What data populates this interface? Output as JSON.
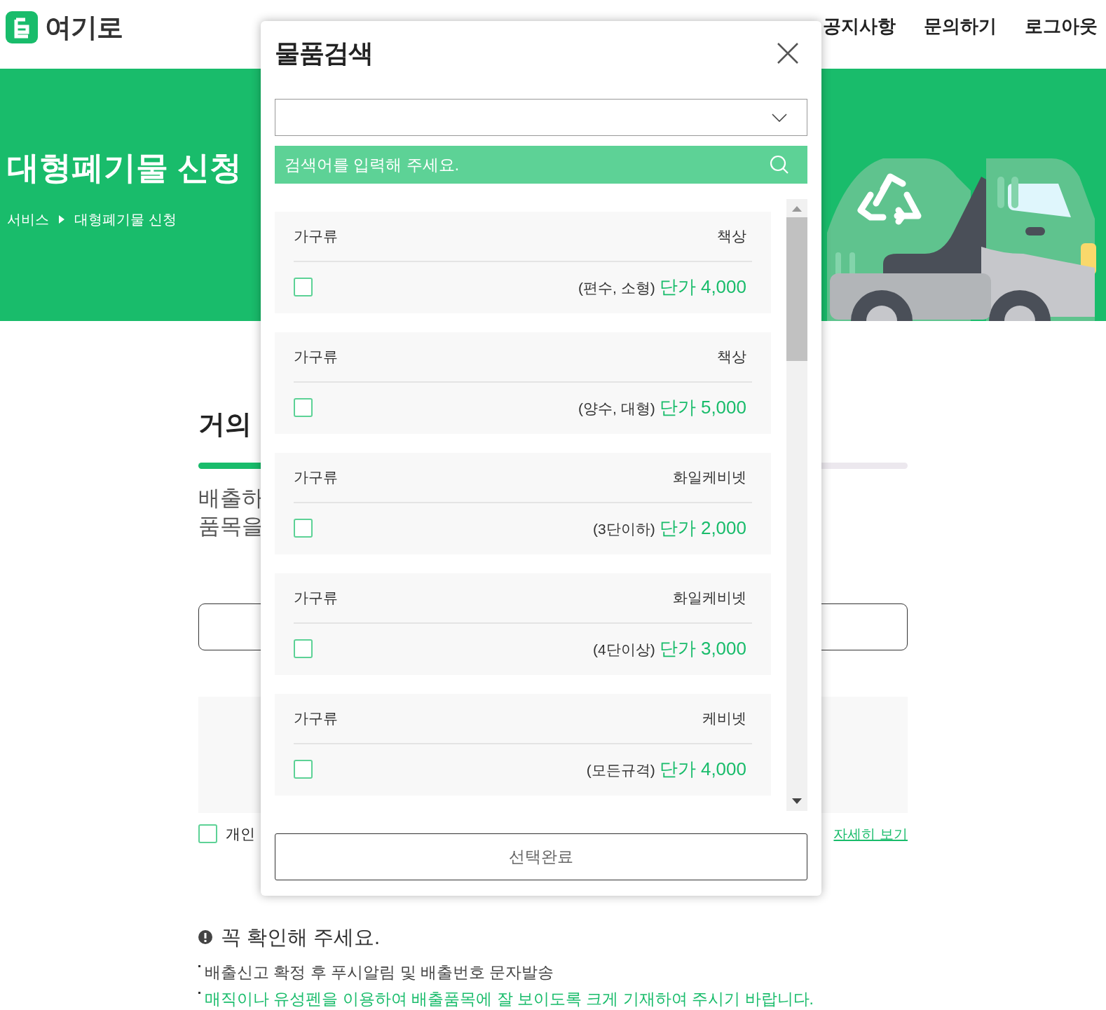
{
  "header": {
    "logo": "여기로",
    "nav": [
      "공지사항",
      "문의하기",
      "로그아웃"
    ]
  },
  "hero": {
    "title": "대형폐기물 신청",
    "breadcrumb": [
      "서비스",
      "대형폐기물 신청"
    ]
  },
  "page": {
    "heading": "거의",
    "progress": {
      "level": 0.3
    },
    "intro": [
      "배출하",
      "품목을"
    ],
    "consent": {
      "label": "개인",
      "checked": false,
      "link": "자세히 보기"
    },
    "notice": {
      "title": "꼭 확인해 주세요.",
      "lines": [
        {
          "text": "배출신고 확정 후 푸시알림 및 배출번호 문자발송",
          "highlight": false
        },
        {
          "text": "매직이나 유성펜을 이용하여 배출품목에 잘 보이도록 크게 기재하여 주시기 바랍니다.",
          "highlight": true
        }
      ]
    }
  },
  "modal": {
    "title": "물품검색",
    "search": {
      "placeholder": "검색어를 입력해 주세요."
    },
    "items": [
      {
        "category": "가구류",
        "name": "책상",
        "spec": "(편수, 소형)",
        "price": "단가 4,000",
        "checked": false
      },
      {
        "category": "가구류",
        "name": "책상",
        "spec": "(양수, 대형)",
        "price": "단가 5,000",
        "checked": false
      },
      {
        "category": "가구류",
        "name": "화일케비넷",
        "spec": "(3단이하)",
        "price": "단가 2,000",
        "checked": false
      },
      {
        "category": "가구류",
        "name": "화일케비넷",
        "spec": "(4단이상)",
        "price": "단가 3,000",
        "checked": false
      },
      {
        "category": "가구류",
        "name": "케비넷",
        "spec": "(모든규격)",
        "price": "단가 4,000",
        "checked": false
      }
    ],
    "button": "선택완료"
  }
}
